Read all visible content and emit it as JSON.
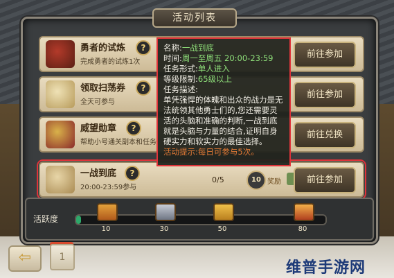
{
  "panel": {
    "title": "活动列表"
  },
  "activities": [
    {
      "name": "勇者的试炼",
      "desc": "完成勇者的试炼1次",
      "help": "?",
      "button": "前往参加"
    },
    {
      "name": "领取扫荡券",
      "desc": "全天可参与",
      "help": "?",
      "button": "前往参加"
    },
    {
      "name": "威望勋章",
      "desc": "帮助小号通关副本和任务",
      "help": "?",
      "button": "前往兑换"
    },
    {
      "name": "一战到底",
      "desc": "20:00-23:59参与",
      "help": "?",
      "button": "前往参加",
      "progress": "0/5",
      "badge": "10",
      "reward_label": "奖励"
    }
  ],
  "tooltip": {
    "name_key": "名称:",
    "name_val": "一战到底",
    "time_key": "时间:",
    "time_val": "周一至周五 20:00-23:59",
    "form_key": "任务形式:",
    "form_val": "单人进入",
    "level_key": "等级限制:",
    "level_val": "65级以上",
    "desc_key": "任务描述:",
    "desc_body": "单凭强悍的体魄和出众的战力是无法统领其他勇士们的,您还需要灵活的头脑和准确的判断,一战到底就是头脑与力量的结合,证明自身硬实力和软实力的最佳选择。",
    "tip": "活动提示:每日可参与5次。"
  },
  "activity_bar": {
    "label": "活跃度",
    "fill_fraction": 0.02,
    "milestones": [
      "10",
      "30",
      "50",
      "80"
    ]
  },
  "bottom": {
    "back_icon": "back-arrow-icon",
    "tab_number": "1"
  },
  "watermark": "维普手游网",
  "colors": {
    "highlight": "#e0343a",
    "tooltip_green": "#8fe07a",
    "tooltip_tip": "#e47a36",
    "progress_fill": "#2ea86a"
  }
}
